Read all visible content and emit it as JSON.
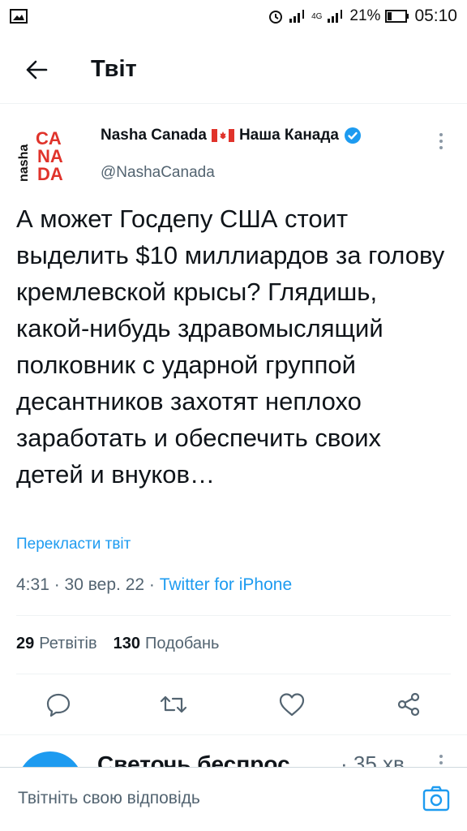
{
  "status_bar": {
    "network": "4G",
    "battery": "21%",
    "time": "05:10"
  },
  "header": {
    "title": "Твіт"
  },
  "tweet": {
    "author_name": "Nasha Canada",
    "author_name_suffix": "Наша Канада",
    "author_handle": "@NashaCanada",
    "avatar_logo_text": "nasha CANADA",
    "text": "А может Госдепу США стоит выделить $10 миллиардов за голову кремлевской крысы? Глядишь, какой-нибудь здравомыслящий полковник с ударной группой десантников захотят неплохо заработать и обеспечить своих детей и внуков…",
    "translate_label": "Перекласти твіт",
    "time": "4:31",
    "date": "30 вер. 22",
    "source": "Twitter for iPhone",
    "retweets_count": "29",
    "retweets_label": "Ретвітів",
    "likes_count": "130",
    "likes_label": "Подобань"
  },
  "reply_preview": {
    "name": "Светочь беспрос",
    "time": "· 35 хв"
  },
  "compose": {
    "placeholder": "Твітніть свою відповідь"
  },
  "colors": {
    "accent": "#1d9bf0",
    "logo_red": "#e0332b",
    "text": "#0f1419",
    "muted": "#536471"
  }
}
